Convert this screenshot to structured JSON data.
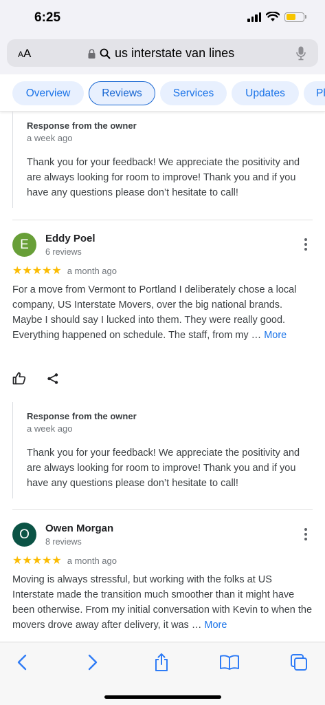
{
  "status_bar": {
    "time": "6:25",
    "battery_color": "#f7c500"
  },
  "url_bar": {
    "aa_label_big": "A",
    "aa_label_small": "A",
    "url": "us interstate van lines",
    "icons": [
      "lock-icon",
      "search-icon",
      "microphone-icon"
    ]
  },
  "tabs": [
    {
      "label": "Overview",
      "active": false
    },
    {
      "label": "Reviews",
      "active": true
    },
    {
      "label": "Services",
      "active": false
    },
    {
      "label": "Updates",
      "active": false
    },
    {
      "label": "Ph",
      "active": false
    }
  ],
  "top_reply": {
    "title": "Response from the owner",
    "time": "a week ago",
    "text": "Thank you for your feedback! We appreciate the positivity and are always looking for room to improve! Thank you and if you have any questions please don’t hesitate to call!"
  },
  "reviews": [
    {
      "initial": "E",
      "avatar_color": "#689f38",
      "name": "Eddy Poel",
      "count": "6 reviews",
      "stars": "★★★★★",
      "rating": 5,
      "date": "a month ago",
      "text": "For a move from Vermont to Portland I deliberately chose a local company, US Interstate Movers, over the big national brands. Maybe I should say I lucked into them. They were really good. Everything happened on schedule. The staff, from my … ",
      "more": "More",
      "reply": {
        "title": "Response from the owner",
        "time": "a week ago",
        "text": "Thank you for your feedback! We appreciate the positivity and are always looking for room to improve! Thank you and if you have any questions please don’t hesitate to call!"
      }
    },
    {
      "initial": "O",
      "avatar_color": "#0b5345",
      "name": "Owen Morgan",
      "count": "8 reviews",
      "stars": "★★★★★",
      "rating": 5,
      "date": "a month ago",
      "text": "Moving is always stressful, but working with the folks at US Interstate made the transition much smoother than it might have been otherwise.  From my initial conversation with Kevin to when the movers drove away after delivery, it was … ",
      "more": "More"
    }
  ],
  "toolbar": {
    "icons": [
      "back-icon",
      "forward-icon",
      "share-icon",
      "bookmarks-icon",
      "tabs-icon"
    ]
  },
  "colors": {
    "accent": "#1a73e8",
    "star": "#fbbc04",
    "chip_bg": "#e8f0fe"
  }
}
